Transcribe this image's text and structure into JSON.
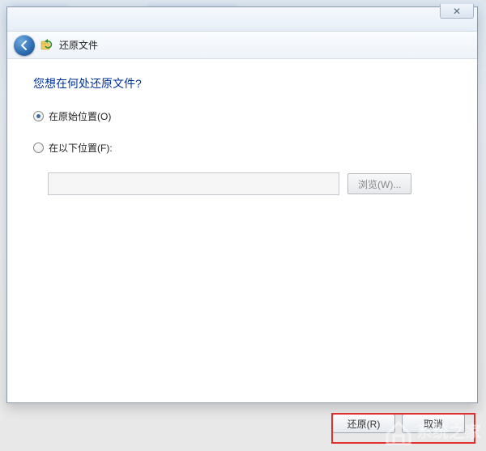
{
  "colors": {
    "heading": "#003399",
    "callout_border": "#e03030"
  },
  "titlebar": {
    "close_glyph": "✕"
  },
  "nav": {
    "title": "还原文件"
  },
  "content": {
    "heading": "您想在何处还原文件?",
    "option_original": "在原始位置(O)",
    "option_custom": "在以下位置(F):",
    "path_value": "",
    "browse_label": "浏览(W)..."
  },
  "footer": {
    "restore_label": "还原(R)",
    "cancel_label": "取消"
  },
  "watermark_text": "系统之家"
}
